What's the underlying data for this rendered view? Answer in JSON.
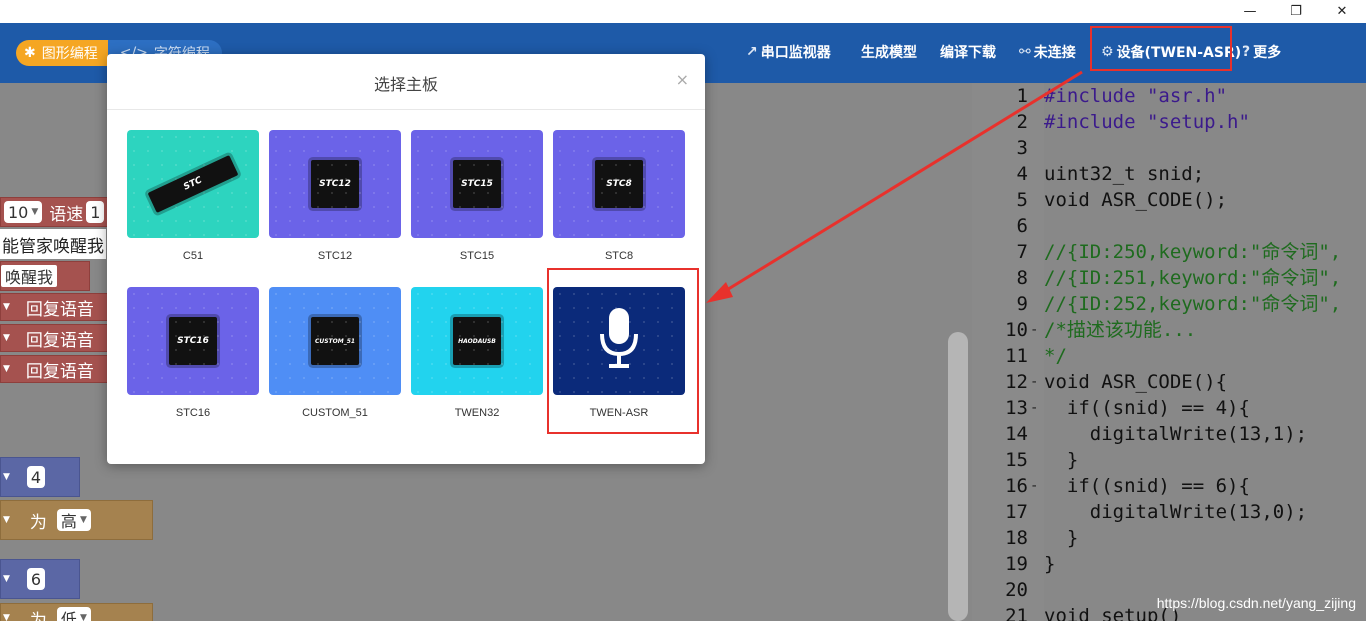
{
  "window": {
    "minimize": "—",
    "restore": "❐",
    "close": "✕"
  },
  "toolbar": {
    "mode_graphic": "图形编程",
    "mode_text": "字符编程",
    "serial_monitor": "串口监视器",
    "generate_model": "生成模型",
    "compile_download": "编译下载",
    "not_connected": "未连接",
    "device": "设备(TWEN-ASR)",
    "more": "更多"
  },
  "workspace": {
    "blocks": {
      "speed_num": "10",
      "speed_label": "语速",
      "speed_val": "1",
      "wake_text": "能管家唤醒我",
      "wake_short": "唤醒我",
      "reply1": "回复语音",
      "reply2": "回复语音",
      "reply3": "回复语音",
      "num4": "4",
      "set_label": "为",
      "level_high": "高",
      "num6": "6",
      "set_label2": "为",
      "level_low": "低"
    }
  },
  "code": {
    "lines": [
      {
        "n": "1",
        "fold": "",
        "text": "#include \"asr.h\""
      },
      {
        "n": "2",
        "fold": "",
        "text": "#include \"setup.h\""
      },
      {
        "n": "3",
        "fold": "",
        "text": ""
      },
      {
        "n": "4",
        "fold": "",
        "text": "uint32_t snid;"
      },
      {
        "n": "5",
        "fold": "",
        "text": "void ASR_CODE();"
      },
      {
        "n": "6",
        "fold": "",
        "text": ""
      },
      {
        "n": "7",
        "fold": "",
        "text": "//{ID:250,keyword:\"命令词\","
      },
      {
        "n": "8",
        "fold": "",
        "text": "//{ID:251,keyword:\"命令词\","
      },
      {
        "n": "9",
        "fold": "",
        "text": "//{ID:252,keyword:\"命令词\","
      },
      {
        "n": "10",
        "fold": "-",
        "text": "/*描述该功能..."
      },
      {
        "n": "11",
        "fold": "",
        "text": "*/"
      },
      {
        "n": "12",
        "fold": "-",
        "text": "void ASR_CODE(){"
      },
      {
        "n": "13",
        "fold": "-",
        "text": "  if((snid) == 4){"
      },
      {
        "n": "14",
        "fold": "",
        "text": "    digitalWrite(13,1);"
      },
      {
        "n": "15",
        "fold": "",
        "text": "  }"
      },
      {
        "n": "16",
        "fold": "-",
        "text": "  if((snid) == 6){"
      },
      {
        "n": "17",
        "fold": "",
        "text": "    digitalWrite(13,0);"
      },
      {
        "n": "18",
        "fold": "",
        "text": "  }"
      },
      {
        "n": "19",
        "fold": "",
        "text": "}"
      },
      {
        "n": "20",
        "fold": "",
        "text": ""
      },
      {
        "n": "21",
        "fold": "",
        "text": "void setup()"
      }
    ],
    "watermark": "https://blog.csdn.net/yang_zijing"
  },
  "modal": {
    "title": "选择主板",
    "close": "×",
    "boards": [
      {
        "name": "C51",
        "chip": "STC",
        "bg": "#2dd4bf",
        "selected": false
      },
      {
        "name": "STC12",
        "chip": "STC12",
        "bg": "#6b63e8",
        "selected": false
      },
      {
        "name": "STC15",
        "chip": "STC15",
        "bg": "#6b63e8",
        "selected": false
      },
      {
        "name": "STC8",
        "chip": "STC8",
        "bg": "#6b63e8",
        "selected": false
      },
      {
        "name": "STC16",
        "chip": "STC16",
        "bg": "#6b63e8",
        "selected": false
      },
      {
        "name": "CUSTOM_51",
        "chip": "CUSTOM_51",
        "bg": "#4f8ef5",
        "selected": false
      },
      {
        "name": "TWEN32",
        "chip": "HAODAUSB",
        "bg": "#22d3ee",
        "selected": false
      },
      {
        "name": "TWEN-ASR",
        "chip": "",
        "bg": "#0b2a7a",
        "selected": true
      }
    ]
  },
  "colors": {
    "toolbar_bg": "#1e5aa8",
    "highlight": "#e8312c",
    "accent_orange": "#f5a623"
  }
}
